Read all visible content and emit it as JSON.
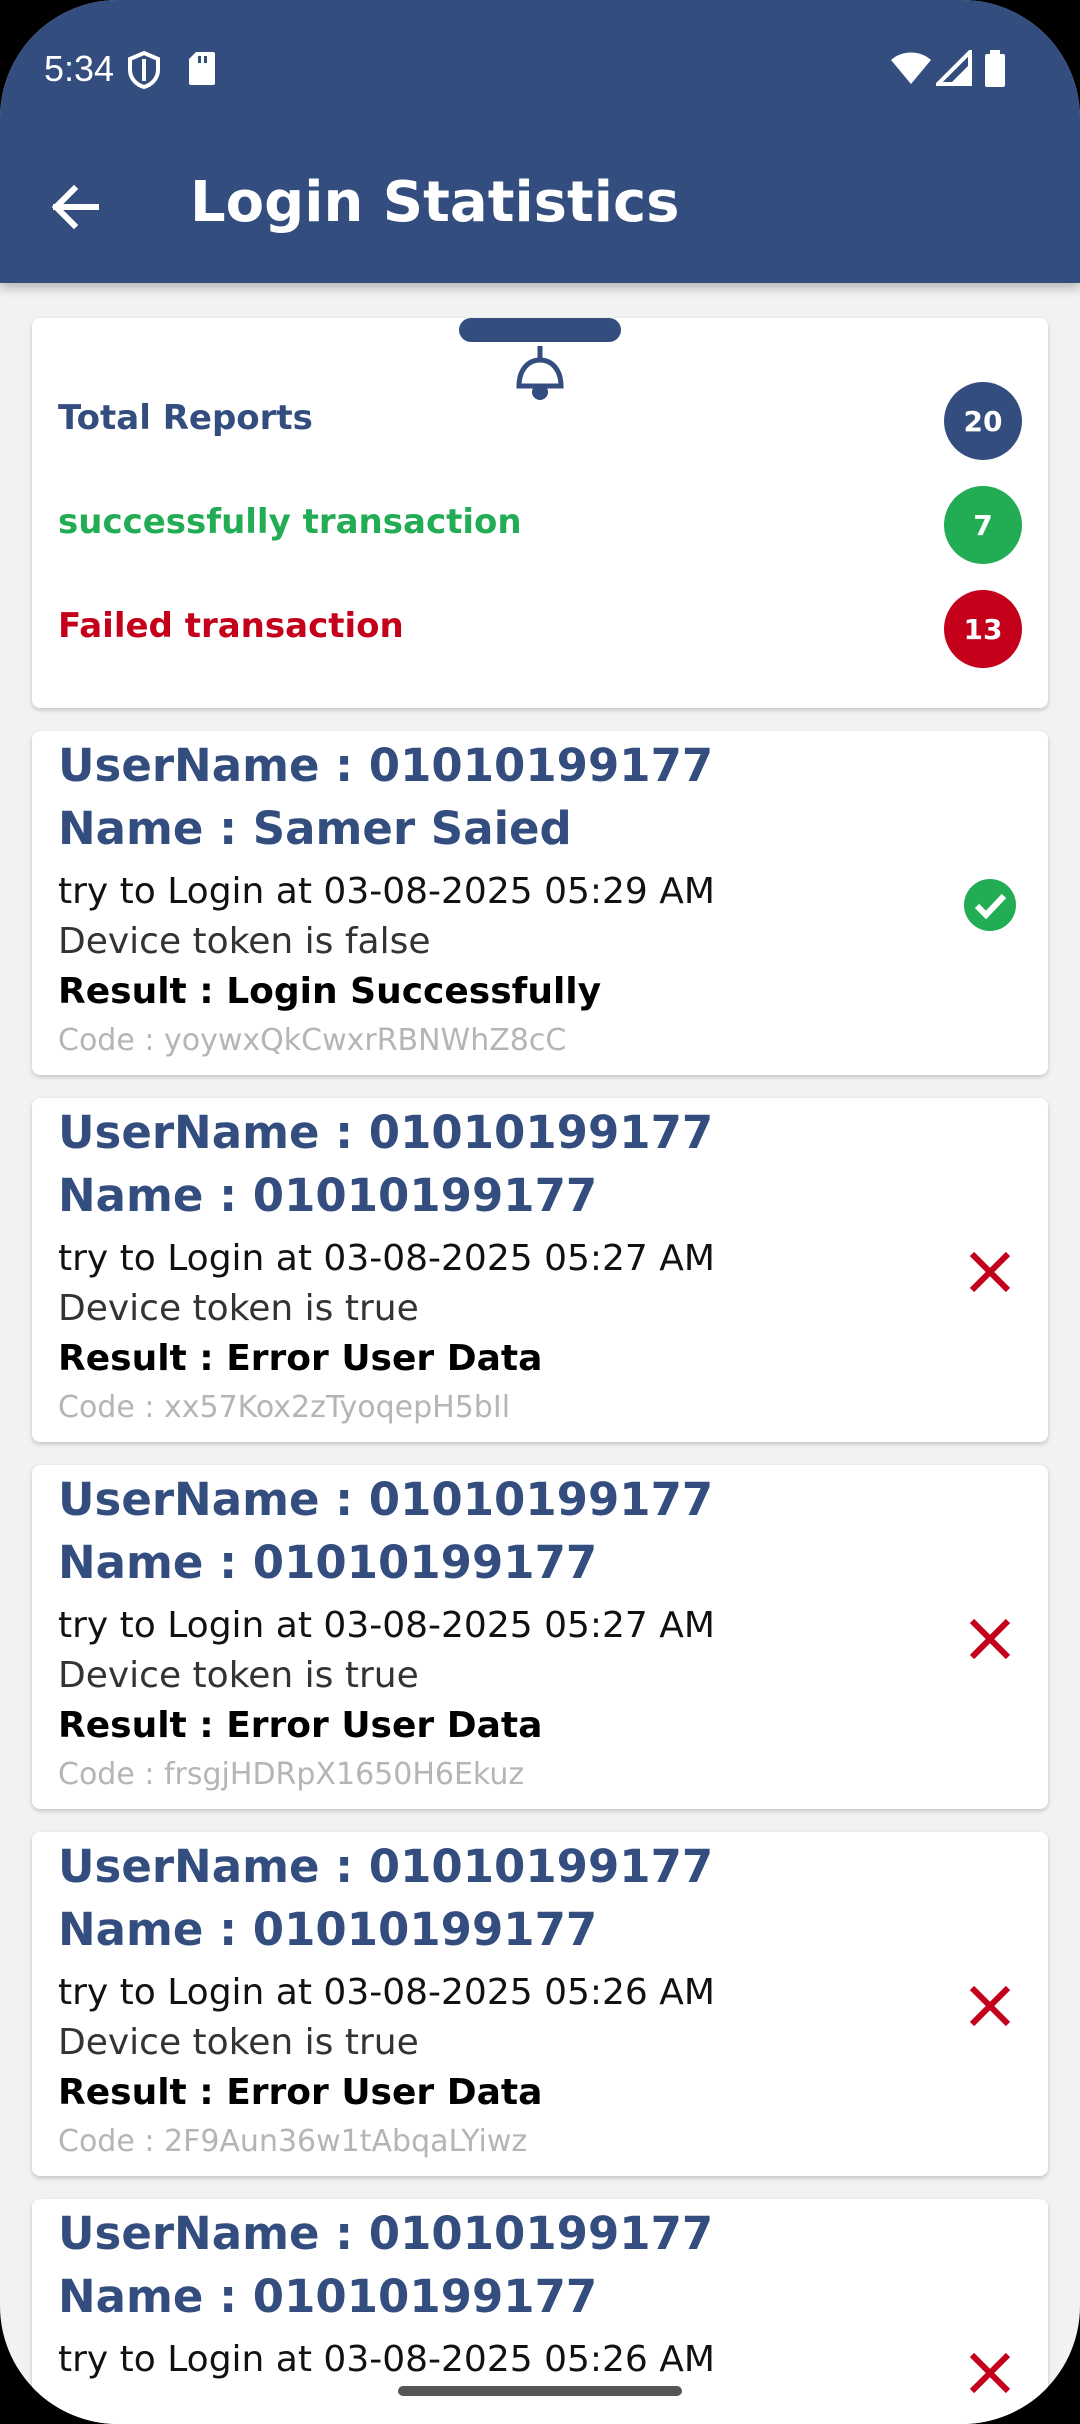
{
  "status_bar": {
    "time": "5:34"
  },
  "app_bar": {
    "title": "Login Statistics"
  },
  "summary": {
    "total_label": "Total Reports",
    "total_count": "20",
    "success_label": "successfully transaction",
    "success_count": "7",
    "failed_label": "Failed transaction",
    "failed_count": "13",
    "colors": {
      "primary": "#334d7f",
      "success": "#22ad55",
      "failed": "#c4001a"
    }
  },
  "reports": [
    {
      "username": "UserName : 01010199177",
      "name": "Name : Samer Saied",
      "time": "try to Login at 03-08-2025 05:29 AM",
      "token": "Device token is false",
      "result": "Result : Login Successfully",
      "code": "Code : yoywxQkCwxrRBNWhZ8cC",
      "status_icon": "check-circle-icon"
    },
    {
      "username": "UserName : 01010199177",
      "name": "Name : 01010199177",
      "time": "try to Login at 03-08-2025 05:27 AM",
      "token": "Device token is true",
      "result": "Result : Error User Data",
      "code": "Code : xx57Kox2zTyoqepH5bIl",
      "status_icon": "close-icon"
    },
    {
      "username": "UserName : 01010199177",
      "name": "Name : 01010199177",
      "time": "try to Login at 03-08-2025 05:27 AM",
      "token": "Device token is true",
      "result": "Result : Error User Data",
      "code": "Code : frsgjHDRpX1650H6Ekuz",
      "status_icon": "close-icon"
    },
    {
      "username": "UserName : 01010199177",
      "name": "Name : 01010199177",
      "time": "try to Login at 03-08-2025 05:26 AM",
      "token": "Device token is true",
      "result": "Result : Error User Data",
      "code": "Code : 2F9Aun36w1tAbqaLYiwz",
      "status_icon": "close-icon"
    },
    {
      "username": "UserName : 01010199177",
      "name": "Name : 01010199177",
      "time": "try to Login at 03-08-2025 05:26 AM",
      "token": "",
      "result": "",
      "code": "",
      "status_icon": "close-icon"
    }
  ]
}
